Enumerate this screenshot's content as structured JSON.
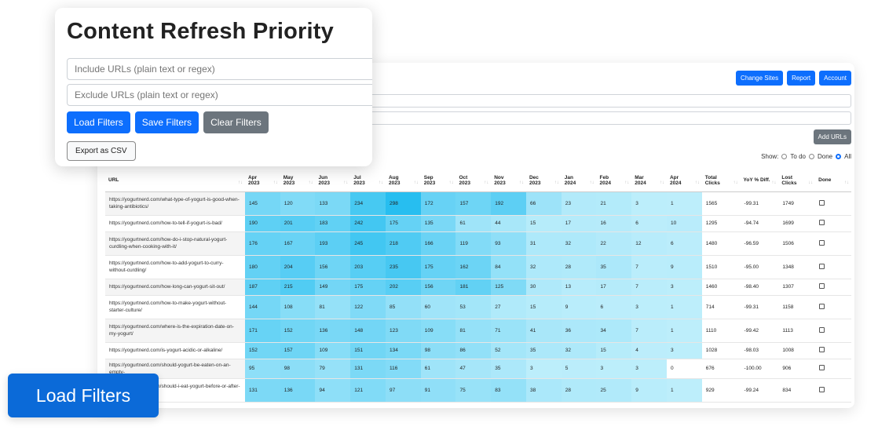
{
  "card": {
    "title": "Content Refresh Priority",
    "include_placeholder": "Include URLs (plain text or regex)",
    "exclude_placeholder": "Exclude URLs (plain text or regex)",
    "load_label": "Load Filters",
    "save_label": "Save Filters",
    "clear_label": "Clear Filters",
    "export_label": "Export as CSV"
  },
  "topbar": {
    "change_sites": "Change Sites",
    "report": "Report",
    "account": "Account"
  },
  "add_urls": "Add URLs",
  "show": {
    "label": "Show:",
    "todo": "To do",
    "done": "Done",
    "all": "All",
    "selected": "All"
  },
  "callout_label": "Load Filters",
  "colors": {
    "accent": "#0d6efd",
    "heat_high": "#2ec4f3",
    "heat_low": "#b8ecfb"
  },
  "table": {
    "headers": [
      "URL",
      "Apr 2023",
      "May 2023",
      "Jun 2023",
      "Jul 2023",
      "Aug 2023",
      "Sep 2023",
      "Oct 2023",
      "Nov 2023",
      "Dec 2023",
      "Jan 2024",
      "Feb 2024",
      "Mar 2024",
      "Apr 2024",
      "Total Clicks",
      "YoY % Diff.",
      "Lost Clicks",
      "Done"
    ],
    "rows": [
      {
        "url": "https://yogurtnerd.com/what-type-of-yogurt-is-good-when-taking-antibiotics/",
        "m": [
          145,
          120,
          133,
          234,
          298,
          172,
          157,
          192,
          66,
          23,
          21,
          3,
          1
        ],
        "total": "1565",
        "yoy": "-99.31",
        "lost": "1749"
      },
      {
        "url": "https://yogurtnerd.com/how-to-tell-if-yogurt-is-bad/",
        "m": [
          190,
          201,
          183,
          242,
          175,
          135,
          61,
          44,
          15,
          17,
          16,
          6,
          10
        ],
        "total": "1295",
        "yoy": "-94.74",
        "lost": "1699"
      },
      {
        "url": "https://yogurtnerd.com/how-do-i-stop-natural-yogurt-curdling-when-cooking-with-it/",
        "m": [
          176,
          167,
          193,
          245,
          218,
          166,
          119,
          93,
          31,
          32,
          22,
          12,
          6
        ],
        "total": "1480",
        "yoy": "-96.59",
        "lost": "1506"
      },
      {
        "url": "https://yogurtnerd.com/how-to-add-yogurt-to-curry-without-curdling/",
        "m": [
          180,
          204,
          156,
          203,
          235,
          175,
          162,
          84,
          32,
          28,
          35,
          7,
          9
        ],
        "total": "1510",
        "yoy": "-95.00",
        "lost": "1348"
      },
      {
        "url": "https://yogurtnerd.com/how-long-can-yogurt-sit-out/",
        "m": [
          187,
          215,
          149,
          175,
          202,
          156,
          181,
          125,
          30,
          13,
          17,
          7,
          3
        ],
        "total": "1460",
        "yoy": "-98.40",
        "lost": "1307"
      },
      {
        "url": "https://yogurtnerd.com/how-to-make-yogurt-without-starter-culture/",
        "m": [
          144,
          108,
          81,
          122,
          85,
          60,
          53,
          27,
          15,
          9,
          6,
          3,
          1
        ],
        "total": "714",
        "yoy": "-99.31",
        "lost": "1158"
      },
      {
        "url": "https://yogurtnerd.com/where-is-the-expiration-date-on-my-yogurt/",
        "m": [
          171,
          152,
          136,
          148,
          123,
          109,
          81,
          71,
          41,
          36,
          34,
          7,
          1
        ],
        "total": "1110",
        "yoy": "-99.42",
        "lost": "1113"
      },
      {
        "url": "https://yogurtnerd.com/is-yogurt-acidic-or-alkaline/",
        "m": [
          152,
          157,
          109,
          151,
          134,
          98,
          86,
          52,
          35,
          32,
          15,
          4,
          3
        ],
        "total": "1028",
        "yoy": "-98.03",
        "lost": "1008"
      },
      {
        "url": "https://yogurtnerd.com/should-yogurt-be-eaten-on-an-empty-",
        "m": [
          95,
          98,
          79,
          131,
          116,
          61,
          47,
          35,
          3,
          5,
          3,
          3,
          0
        ],
        "total": "676",
        "yoy": "-100.00",
        "lost": "906"
      },
      {
        "url": "https://yogurtnerd.com/should-i-eat-yogurt-before-or-after-a-",
        "m": [
          131,
          136,
          94,
          121,
          97,
          91,
          75,
          83,
          38,
          28,
          25,
          9,
          1
        ],
        "total": "929",
        "yoy": "-99.24",
        "lost": "834"
      }
    ]
  }
}
